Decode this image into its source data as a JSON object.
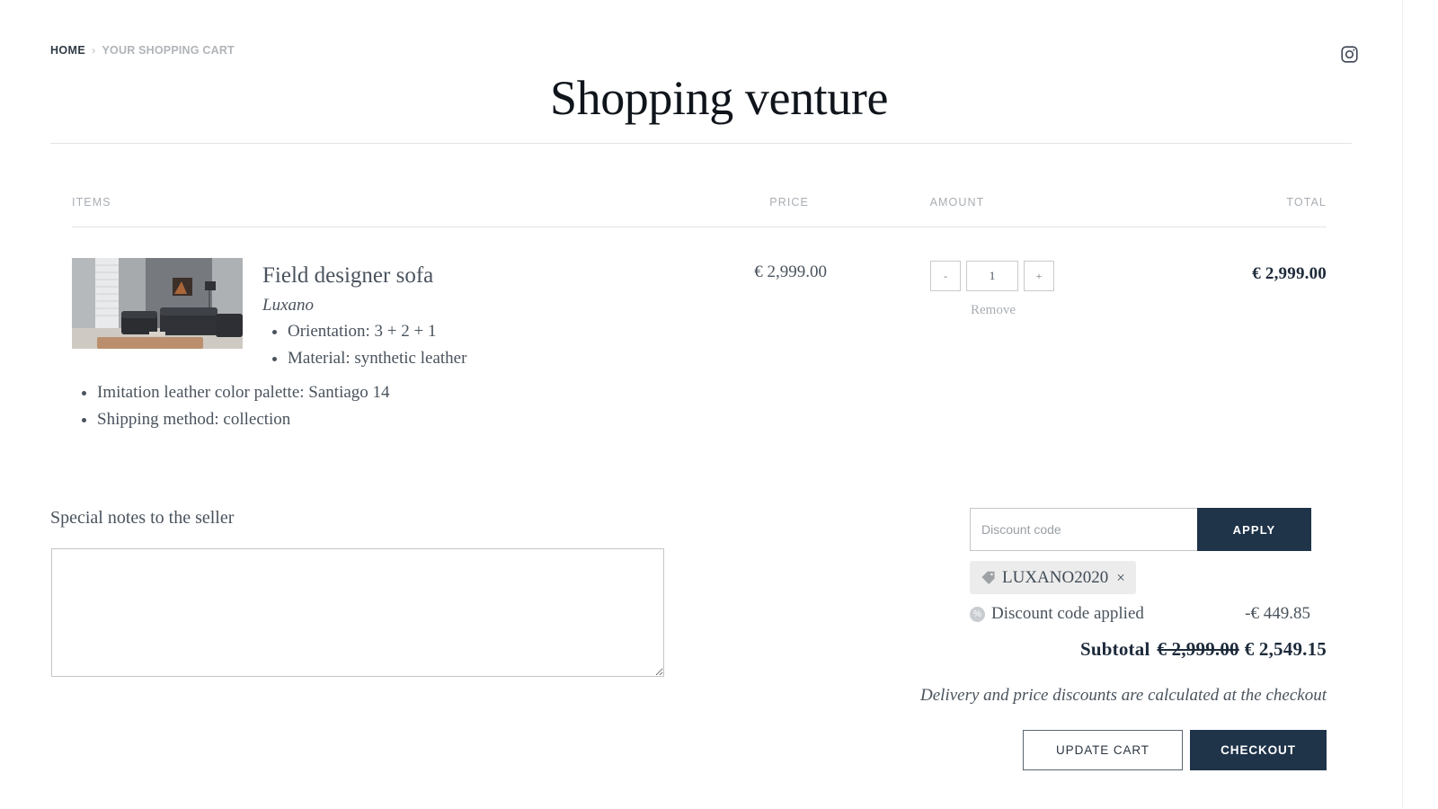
{
  "breadcrumb": {
    "home": "HOME",
    "separator": "›",
    "current": "YOUR SHOPPING CART"
  },
  "header": {
    "title": "Shopping venture",
    "social_icon": "instagram-icon"
  },
  "cart": {
    "columns": {
      "items": "ITEMS",
      "price": "PRICE",
      "amount": "AMOUNT",
      "total": "TOTAL"
    },
    "item": {
      "thumbnail_alt": "grayscale living room with tufted sofas",
      "name": "Field designer sofa",
      "brand": "Luxano",
      "options_primary": [
        "Orientation: 3 + 2 + 1",
        "Material: synthetic leather"
      ],
      "options_secondary": [
        "Imitation leather color palette: Santiago 14",
        "Shipping method: collection"
      ],
      "price": "€ 2,999.00",
      "qty_decrement": "-",
      "qty_value": "1",
      "qty_increment": "+",
      "remove_label": "Remove",
      "line_total": "€ 2,999.00"
    }
  },
  "notes": {
    "label": "Special notes to the seller",
    "value": "",
    "placeholder": ""
  },
  "summary": {
    "discount_placeholder": "Discount code",
    "discount_value": "",
    "apply_label": "APPLY",
    "applied_code": "LUXANO2020",
    "chip_tag_icon": "tag-icon",
    "chip_remove_icon": "×",
    "discount_applied_label": "Discount code applied",
    "discount_applied_icon": "percent-badge-icon",
    "discount_applied_amount": "-€ 449.85",
    "subtotal_label": "Subtotal",
    "subtotal_original": "€ 2,999.00",
    "subtotal_final": "€ 2,549.15",
    "delivery_note": "Delivery and price discounts are calculated at the checkout",
    "update_cart_label": "UPDATE CART",
    "checkout_label": "CHECKOUT"
  },
  "colors": {
    "accent_dark": "#1f3349",
    "text": "#4a535d",
    "muted": "#a9aeb3",
    "chip_bg": "#ececec"
  }
}
